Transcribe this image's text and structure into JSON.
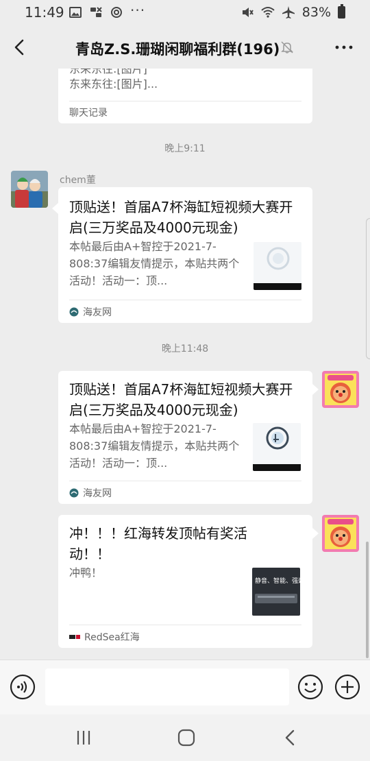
{
  "status_bar": {
    "time": "11:49",
    "battery": "83%",
    "icons_left": [
      "gallery-icon",
      "message-icon",
      "app-icon",
      "more-dots-icon"
    ],
    "icons_right": [
      "mute-icon",
      "wifi-icon",
      "airplane-icon",
      "battery-icon"
    ]
  },
  "header": {
    "title": "青岛Z.S.珊瑚闲聊福利群(196)",
    "icons": [
      "back-icon",
      "mute-bell-icon",
      "more-icon"
    ]
  },
  "messages": {
    "top_card": {
      "line1": "东来东往:[图片]",
      "line2": "东来东往:[图片]...",
      "footer": "聊天记录"
    },
    "ts1": "晚上9:11",
    "msg1": {
      "sender": "chem董",
      "title": "顶贴送！首届A7杯海缸短视频大赛开启(三万奖品及4000元现金)",
      "desc": "本帖最后由A+智控于2021-7-808:37编辑友情提示，本贴共两个活动！活动一：顶...",
      "source": "海友网"
    },
    "ts2": "晚上11:48",
    "msg2": {
      "title": "顶贴送！首届A7杯海缸短视频大赛开启(三万奖品及4000元现金)",
      "desc": "本帖最后由A+智控于2021-7-808:37编辑友情提示，本贴共两个活动！活动一：顶...",
      "source": "海友网"
    },
    "msg3": {
      "title": "冲！！！红海转发顶帖有奖活动！！",
      "desc": "冲鸭！",
      "source": "RedSea红海",
      "thumb_text": "静音、智能、强劲"
    }
  },
  "input_bar": {
    "placeholder": "",
    "icons": [
      "voice-icon",
      "emoji-icon",
      "plus-icon"
    ]
  },
  "nav_bar": {
    "icons": [
      "recent-apps-icon",
      "home-icon",
      "back-nav-icon"
    ]
  },
  "colors": {
    "background": "#ededed",
    "card": "#ffffff",
    "meta_text": "#888888"
  }
}
